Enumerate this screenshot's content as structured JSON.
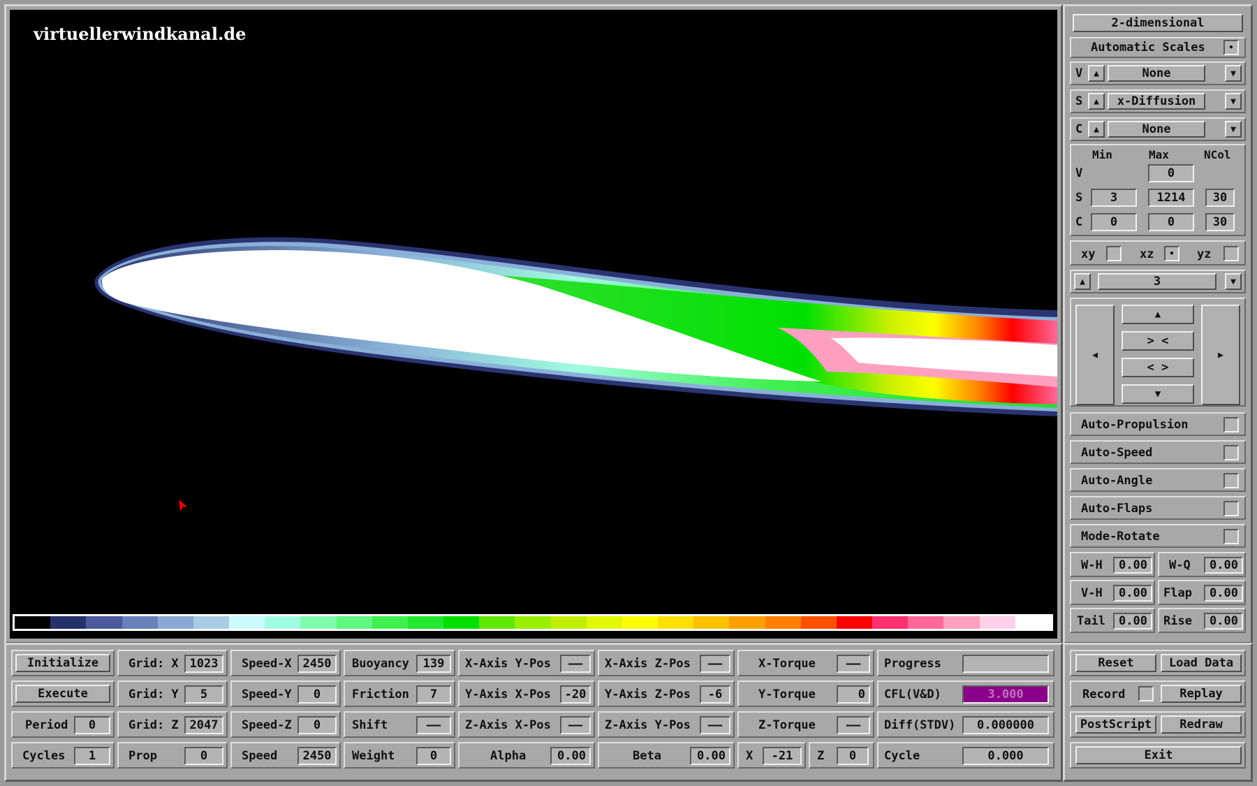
{
  "site": "virtuellerwindkanal.de",
  "colorbar": [
    "#000000",
    "#26306a",
    "#4a5a9a",
    "#6a80b8",
    "#8aa8d4",
    "#a8cce4",
    "#cafcff",
    "#a0fce0",
    "#80fcb0",
    "#60f880",
    "#40f050",
    "#20e830",
    "#00e000",
    "#60e800",
    "#98f000",
    "#c0f000",
    "#e0f800",
    "#ffff00",
    "#ffe000",
    "#ffc000",
    "#ffa000",
    "#ff8000",
    "#ff5000",
    "#ff0000",
    "#ff3070",
    "#ff6898",
    "#ffa0c0",
    "#ffd0e8",
    "#ffffff"
  ],
  "side": {
    "mode_button": "2-dimensional",
    "auto_scales": "Automatic Scales",
    "auto_scales_mark": "•",
    "selectors": [
      {
        "key": "V",
        "value": "None"
      },
      {
        "key": "S",
        "value": "x-Diffusion"
      },
      {
        "key": "C",
        "value": "None"
      }
    ],
    "ranges": {
      "h_min": "Min",
      "h_max": "Max",
      "h_ncol": "NCol",
      "v_key": "V",
      "v_max": "0",
      "s_key": "S",
      "s_min": "3",
      "s_max": "1214",
      "s_ncol": "30",
      "c_key": "C",
      "c_min": "0",
      "c_max": "0",
      "c_ncol": "30"
    },
    "planes": {
      "xy": "xy",
      "xz": "xz",
      "yz": "yz",
      "xz_mark": "•"
    },
    "slice": "3",
    "nav": {
      "up": "▲",
      "zoom_in": "> <",
      "zoom_out": "< >",
      "down": "▼",
      "left": "◀",
      "right": "▶"
    },
    "toggles": [
      "Auto-Propulsion",
      "Auto-Speed",
      "Auto-Angle",
      "Auto-Flaps",
      "Mode-Rotate"
    ],
    "params": [
      {
        "label": "W-H",
        "value": "0.00"
      },
      {
        "label": "W-Q",
        "value": "0.00"
      },
      {
        "label": "V-H",
        "value": "0.00"
      },
      {
        "label": "Flap",
        "value": "0.00"
      },
      {
        "label": "Tail",
        "value": "0.00"
      },
      {
        "label": "Rise",
        "value": "0.00"
      }
    ]
  },
  "bottom": {
    "initialize": "Initialize",
    "execute": "Execute",
    "period_label": "Period",
    "period": "0",
    "cycles_label": "Cycles",
    "cycles": "1",
    "grid_x_label": "Grid: X",
    "grid_x": "1023",
    "grid_y_label": "Grid: Y",
    "grid_y": "5",
    "grid_z_label": "Grid: Z",
    "grid_z": "2047",
    "prop_label": "Prop",
    "prop": "0",
    "speed_x_label": "Speed-X",
    "speed_x": "2450",
    "speed_y_label": "Speed-Y",
    "speed_y": "0",
    "speed_z_label": "Speed-Z",
    "speed_z": "0",
    "speed_label": "Speed",
    "speed": "2450",
    "buoyancy_label": "Buoyancy",
    "buoyancy": "139",
    "friction_label": "Friction",
    "friction": "7",
    "shift_label": "Shift",
    "shift": "——",
    "weight_label": "Weight",
    "weight": "0",
    "xaxis_ypos_label": "X-Axis Y-Pos",
    "xaxis_ypos": "——",
    "yaxis_xpos_label": "Y-Axis X-Pos",
    "yaxis_xpos": "-20",
    "zaxis_xpos_label": "Z-Axis X-Pos",
    "zaxis_xpos": "——",
    "alpha_label": "Alpha",
    "alpha": "0.00",
    "xaxis_zpos_label": "X-Axis Z-Pos",
    "xaxis_zpos": "——",
    "yaxis_zpos_label": "Y-Axis Z-Pos",
    "yaxis_zpos": "-6",
    "zaxis_ypos_label": "Z-Axis Y-Pos",
    "zaxis_ypos": "——",
    "beta_label": "Beta",
    "beta": "0.00",
    "x_torque_label": "X-Torque",
    "x_torque": "——",
    "y_torque_label": "Y-Torque",
    "y_torque": "0",
    "z_torque_label": "Z-Torque",
    "z_torque": "——",
    "x_label": "X",
    "x_val": "-21",
    "z_label": "Z",
    "z_val": "0",
    "progress_label": "Progress",
    "progress": 0.0,
    "cfl_label": "CFL(V&D)",
    "cfl": "3.000",
    "diff_label": "Diff(STDV)",
    "diff": "0.000000",
    "cycle_label": "Cycle",
    "cycle": "0.000",
    "reset": "Reset",
    "load_data": "Load Data",
    "record": "Record",
    "replay": "Replay",
    "postscript": "PostScript",
    "redraw": "Redraw",
    "exit": "Exit"
  },
  "colors": {
    "cfl_fill": "#8a008a",
    "field_bg": "#b4b4b4"
  }
}
